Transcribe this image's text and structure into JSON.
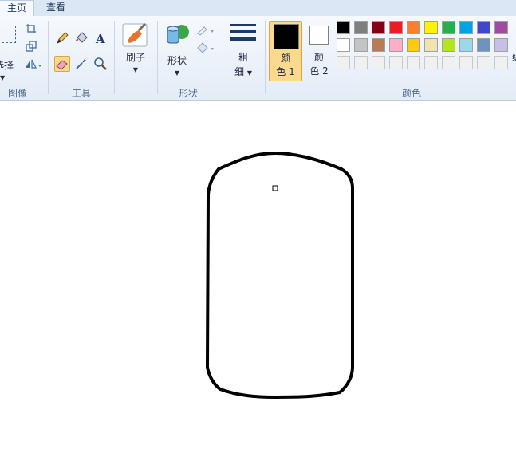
{
  "tabs": [
    {
      "label": "主页",
      "active": true
    },
    {
      "label": "查看",
      "active": false
    }
  ],
  "groups": {
    "image": {
      "label": "图像",
      "select_label": "选择"
    },
    "tools": {
      "label": "工具"
    },
    "brushes": {
      "label": "刷子"
    },
    "shapes": {
      "group_label": "形状",
      "button_label": "形状"
    },
    "size": {
      "label_line1": "粗",
      "label_line2": "细"
    },
    "color1": {
      "line1": "颜",
      "line2": "色 1",
      "value": "#000000"
    },
    "color2": {
      "line1": "颜",
      "line2": "色 2",
      "value": "#ffffff"
    },
    "colors": {
      "label": "颜色"
    }
  },
  "palette": {
    "row1": [
      "#000000",
      "#7f7f7f",
      "#880015",
      "#ed1c24",
      "#ff7f27",
      "#fff200",
      "#22b14c",
      "#00a2e8",
      "#3f48cc",
      "#a349a4"
    ],
    "row2": [
      "#ffffff",
      "#c3c3c3",
      "#b97a57",
      "#ffaec9",
      "#ffc90e",
      "#efe4b0",
      "#b5e61d",
      "#99d9ea",
      "#7092be",
      "#c8bfe7"
    ],
    "row3": [
      "#f0f0f0",
      "#f0f0f0",
      "#f0f0f0",
      "#f0f0f0",
      "#f0f0f0",
      "#f0f0f0",
      "#f0f0f0",
      "#f0f0f0",
      "#f0f0f0",
      "#f0f0f0"
    ]
  },
  "edit_colors_fragment": "编"
}
